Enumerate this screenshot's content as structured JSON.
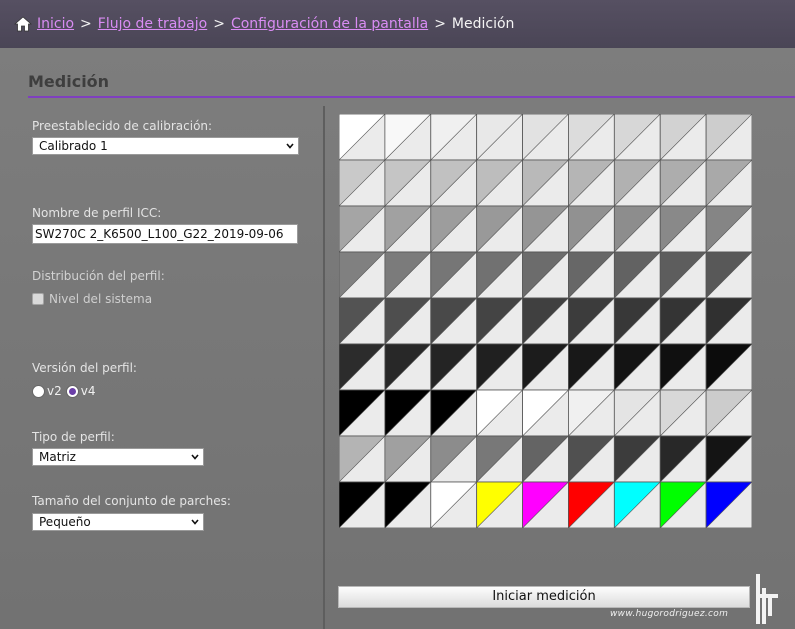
{
  "breadcrumb": {
    "items": [
      "Inicio",
      "Flujo de trabajo",
      "Configuración de la pantalla"
    ],
    "separator": ">",
    "current": "Medición"
  },
  "page_title": "Medición",
  "calibration_preset": {
    "label": "Preestablecido de calibración:",
    "value": "Calibrado 1"
  },
  "icc_profile": {
    "label": "Nombre de perfil ICC:",
    "value": "SW270C 2_K6500_L100_G22_2019-09-06"
  },
  "profile_distribution": {
    "label": "Distribución del perfil:",
    "checkbox_label": "Nivel del sistema",
    "checked": false
  },
  "profile_version": {
    "label": "Versión del perfil:",
    "options": [
      "v2",
      "v4"
    ],
    "selected": "v4"
  },
  "profile_type": {
    "label": "Tipo de perfil:",
    "value": "Matriz"
  },
  "patch_set_size": {
    "label": "Tamaño del conjunto de parches:",
    "value": "Pequeño"
  },
  "patch_grid": {
    "rows": [
      [
        [
          "#ffffff",
          "#ebebeb"
        ],
        [
          "#f8f8f8",
          "#ebebeb"
        ],
        [
          "#f0f0f0",
          "#ebebeb"
        ],
        [
          "#e8e8e8",
          "#ebebeb"
        ],
        [
          "#e2e2e2",
          "#ebebeb"
        ],
        [
          "#dcdcdc",
          "#ebebeb"
        ],
        [
          "#d7d7d7",
          "#ebebeb"
        ],
        [
          "#d2d2d2",
          "#ebebeb"
        ],
        [
          "#cdcdcd",
          "#ebebeb"
        ]
      ],
      [
        [
          "#c9c9c9",
          "#ebebeb"
        ],
        [
          "#c5c5c5",
          "#ebebeb"
        ],
        [
          "#c1c1c1",
          "#ebebeb"
        ],
        [
          "#bdbdbd",
          "#ebebeb"
        ],
        [
          "#b9b9b9",
          "#ebebeb"
        ],
        [
          "#b5b5b5",
          "#ebebeb"
        ],
        [
          "#b1b1b1",
          "#ebebeb"
        ],
        [
          "#adadad",
          "#ebebeb"
        ],
        [
          "#a9a9a9",
          "#ebebeb"
        ]
      ],
      [
        [
          "#a5a5a5",
          "#ebebeb"
        ],
        [
          "#a1a1a1",
          "#ebebeb"
        ],
        [
          "#9d9d9d",
          "#ebebeb"
        ],
        [
          "#999999",
          "#ebebeb"
        ],
        [
          "#959595",
          "#ebebeb"
        ],
        [
          "#919191",
          "#ebebeb"
        ],
        [
          "#8d8d8d",
          "#ebebeb"
        ],
        [
          "#898989",
          "#ebebeb"
        ],
        [
          "#858585",
          "#ebebeb"
        ]
      ],
      [
        [
          "#808080",
          "#ebebeb"
        ],
        [
          "#7b7b7b",
          "#ebebeb"
        ],
        [
          "#767676",
          "#ebebeb"
        ],
        [
          "#717171",
          "#ebebeb"
        ],
        [
          "#6c6c6c",
          "#ebebeb"
        ],
        [
          "#676767",
          "#ebebeb"
        ],
        [
          "#626262",
          "#ebebeb"
        ],
        [
          "#5d5d5d",
          "#ebebeb"
        ],
        [
          "#585858",
          "#ebebeb"
        ]
      ],
      [
        [
          "#535353",
          "#ebebeb"
        ],
        [
          "#4e4e4e",
          "#ebebeb"
        ],
        [
          "#494949",
          "#ebebeb"
        ],
        [
          "#444444",
          "#ebebeb"
        ],
        [
          "#404040",
          "#ebebeb"
        ],
        [
          "#3c3c3c",
          "#ebebeb"
        ],
        [
          "#383838",
          "#ebebeb"
        ],
        [
          "#343434",
          "#ebebeb"
        ],
        [
          "#303030",
          "#ebebeb"
        ]
      ],
      [
        [
          "#2c2c2c",
          "#ebebeb"
        ],
        [
          "#282828",
          "#ebebeb"
        ],
        [
          "#242424",
          "#ebebeb"
        ],
        [
          "#202020",
          "#ebebeb"
        ],
        [
          "#1c1c1c",
          "#ebebeb"
        ],
        [
          "#181818",
          "#ebebeb"
        ],
        [
          "#141414",
          "#ebebeb"
        ],
        [
          "#101010",
          "#ebebeb"
        ],
        [
          "#0c0c0c",
          "#ebebeb"
        ]
      ],
      [
        [
          "#000000",
          "#ebebeb"
        ],
        [
          "#000000",
          "#ebebeb"
        ],
        [
          "#000000",
          "#ebebeb"
        ],
        [
          "#ffffff",
          "#ebebeb"
        ],
        [
          "#ffffff",
          "#ebebeb"
        ],
        [
          "#f0f0f0",
          "#ebebeb"
        ],
        [
          "#e4e4e4",
          "#ebebeb"
        ],
        [
          "#d8d8d8",
          "#ebebeb"
        ],
        [
          "#cccccc",
          "#ebebeb"
        ]
      ],
      [
        [
          "#b4b4b4",
          "#ebebeb"
        ],
        [
          "#a0a0a0",
          "#ebebeb"
        ],
        [
          "#8c8c8c",
          "#ebebeb"
        ],
        [
          "#787878",
          "#ebebeb"
        ],
        [
          "#646464",
          "#ebebeb"
        ],
        [
          "#505050",
          "#ebebeb"
        ],
        [
          "#3c3c3c",
          "#ebebeb"
        ],
        [
          "#282828",
          "#ebebeb"
        ],
        [
          "#141414",
          "#ebebeb"
        ]
      ],
      [
        [
          "#000000",
          "#ebebeb"
        ],
        [
          "#000000",
          "#ebebeb"
        ],
        [
          "#ffffff",
          "#ebebeb"
        ],
        [
          "#ffff00",
          "#ebebeb"
        ],
        [
          "#ff00ff",
          "#ebebeb"
        ],
        [
          "#ff0000",
          "#ebebeb"
        ],
        [
          "#00ffff",
          "#ebebeb"
        ],
        [
          "#00ff00",
          "#ebebeb"
        ],
        [
          "#0000ff",
          "#ebebeb"
        ]
      ]
    ]
  },
  "start_button": {
    "label": "Iniciar medición"
  },
  "watermark": "www.hugorodriguez.com",
  "colors": {
    "accent": "#7f3fbf",
    "link": "#d98cf3",
    "topbar": "#4f4a5b"
  }
}
